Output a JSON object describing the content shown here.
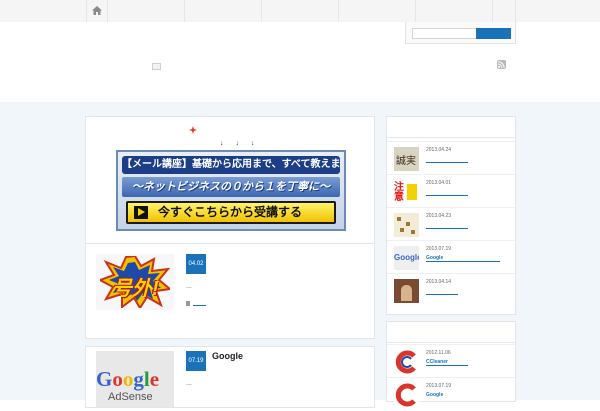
{
  "banner": {
    "arrows": "↓ ↓ ↓",
    "top": "【メール講座】基礎から応用まで、すべて教えます！",
    "middle": "〜ネットビジネスの０から１を丁寧に〜",
    "button": "今すぐこちらから受講する"
  },
  "posts": [
    {
      "date": "04.02",
      "title": "",
      "excerpt": "...",
      "image_text": "号外!"
    },
    {
      "date": "07.19",
      "title": "Google",
      "excerpt": "...",
      "image_text": [
        "Google",
        "AdSense"
      ]
    }
  ],
  "sidebar": {
    "section1": [
      {
        "date": "2013.04.24",
        "title": "",
        "thumb_text": "誠実"
      },
      {
        "date": "2013.04.01",
        "title": "",
        "thumb_text": "注意"
      },
      {
        "date": "2013.04.23",
        "title": "",
        "thumb_text": ""
      },
      {
        "date": "2013.07.19",
        "title": "Google",
        "thumb_text": "Google"
      },
      {
        "date": "2013.04.14",
        "title": "",
        "thumb_text": ""
      }
    ],
    "section2": [
      {
        "date": "2012.11.06",
        "title": "CCleaner",
        "thumb_text": ""
      },
      {
        "date": "2013.07.19",
        "title": "Google",
        "thumb_text": ""
      }
    ]
  },
  "icons": {
    "home": "home-icon",
    "rss": "rss-icon"
  },
  "colors": {
    "accent": "#1a73b8",
    "page_bg": "#f1f6fb"
  }
}
